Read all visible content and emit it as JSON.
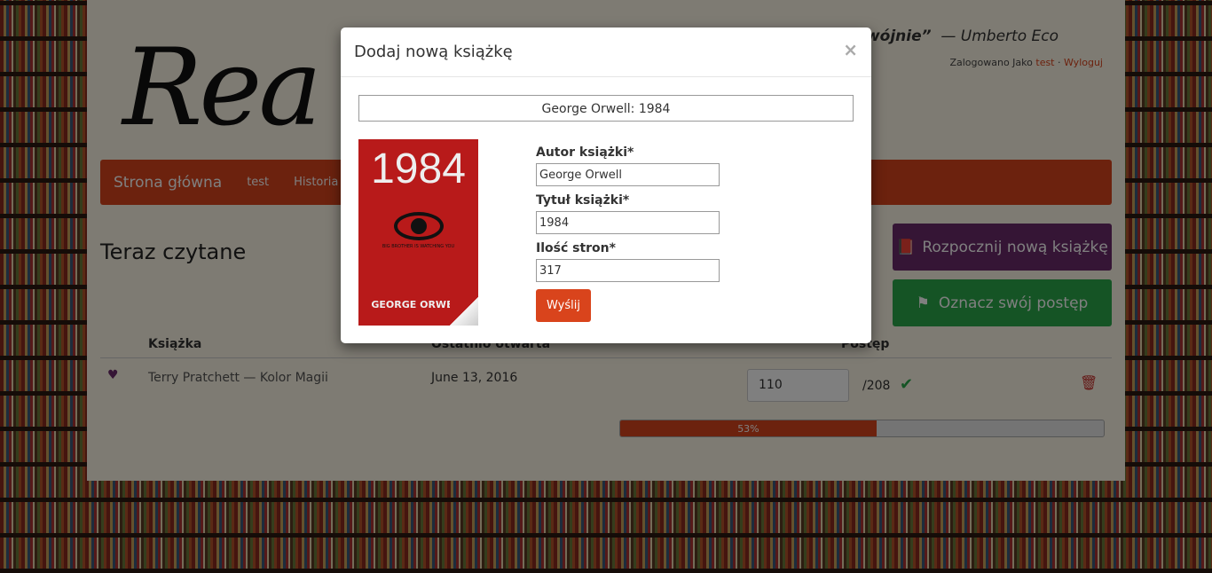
{
  "background": {
    "logo_text": "Rea",
    "quote_bold": "dwójnie”",
    "quote_author": "— Umberto Eco"
  },
  "header": {
    "login_prefix": "Zalogowano Jako",
    "username": "test",
    "separator": "·",
    "logout": "Wyloguj"
  },
  "navbar": {
    "brand": "Strona główna",
    "items": [
      "test",
      "Historia c"
    ]
  },
  "main": {
    "heading": "Teraz czytane",
    "start_button": "Rozpocznij nową książkę",
    "progress_button": "Oznacz swój postęp",
    "table": {
      "headers": [
        "Książka",
        "Ostatnio otwarta",
        "Postęp"
      ],
      "rows": [
        {
          "book": "Terry Pratchett — Kolor Magii",
          "date": "June 13, 2016",
          "current_page": "110",
          "total_pages": "/208"
        }
      ]
    },
    "progress": {
      "percent": 53,
      "label": "53%"
    }
  },
  "modal": {
    "title": "Dodaj nową książkę",
    "close": "×",
    "search_value": "George Orwell: 1984",
    "cover": {
      "title": "1984",
      "tagline": "BIG BROTHER IS WATCHING YOU",
      "author": "GEORGE ORWELL"
    },
    "author_label": "Autor książki*",
    "author_value": "George Orwell",
    "title_label": "Tytuł książki*",
    "title_value": "1984",
    "pages_label": "Ilość stron*",
    "pages_value": "317",
    "submit": "Wyślij"
  },
  "colors": {
    "accent": "#d9441c",
    "purple": "#6a2a6a",
    "green": "#2aa84a"
  }
}
